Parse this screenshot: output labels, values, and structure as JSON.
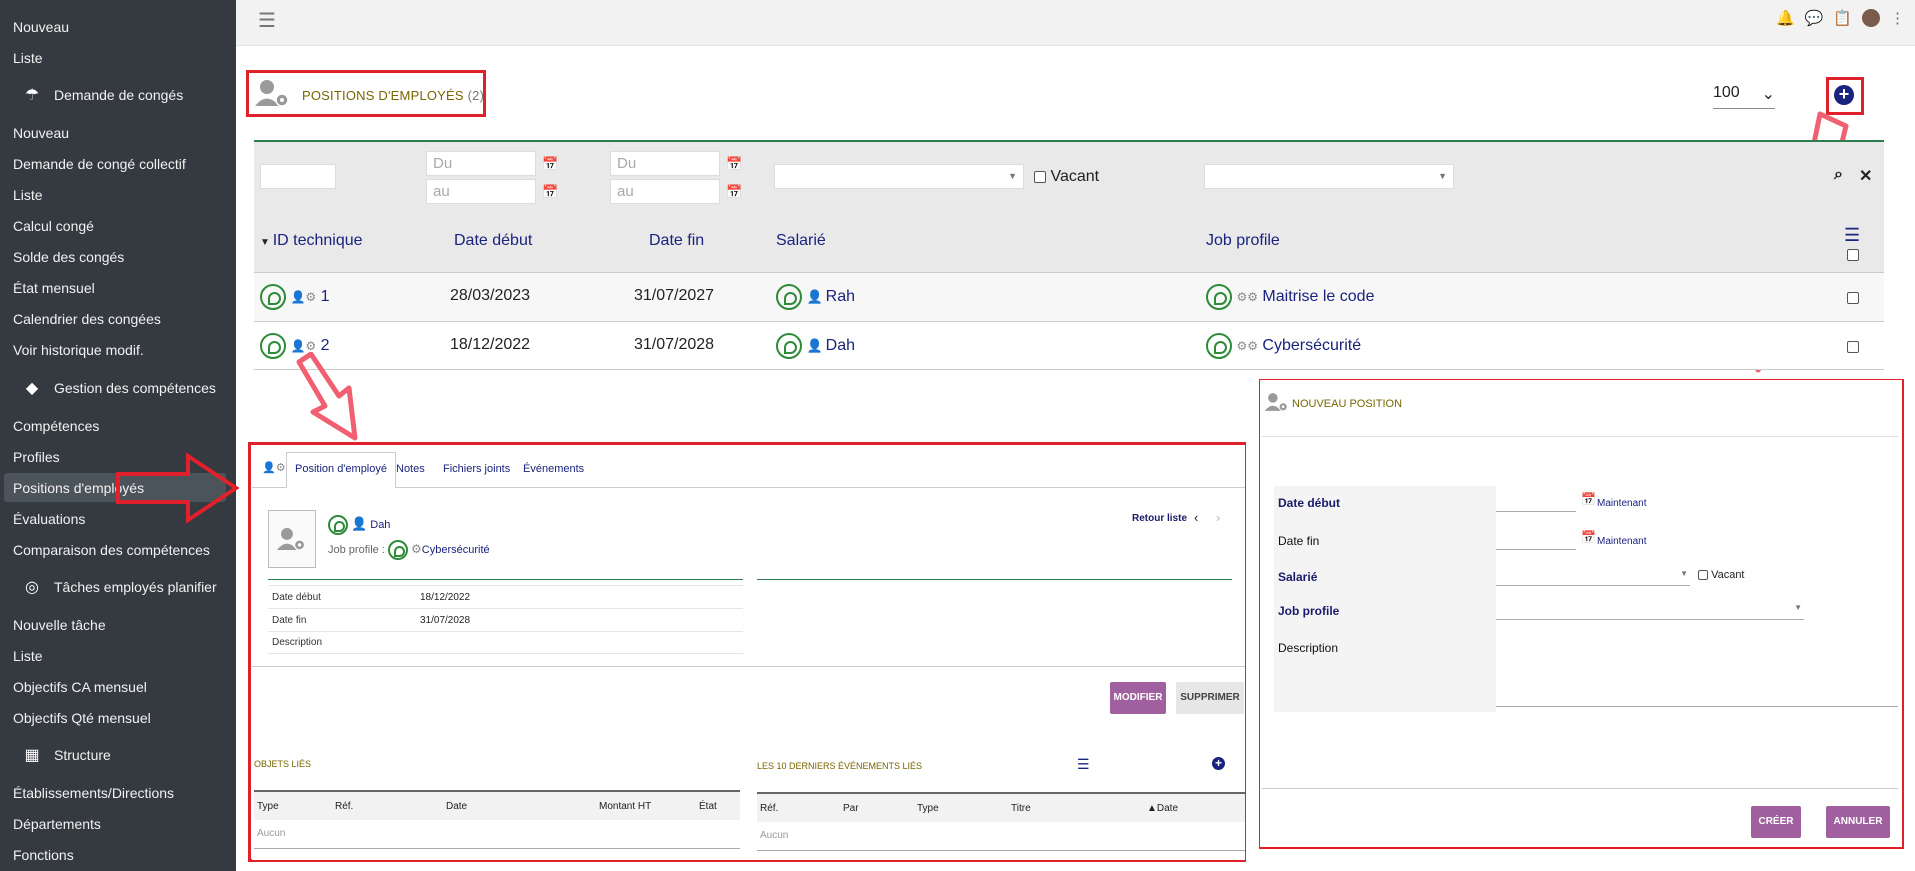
{
  "sidebar": {
    "items": [
      {
        "label": "Nouveau"
      },
      {
        "label": "Liste"
      },
      {
        "label": "Demande de congés",
        "section": true,
        "icon": "umbrella-icon"
      },
      {
        "label": "Nouveau"
      },
      {
        "label": "Demande de congé collectif"
      },
      {
        "label": "Liste"
      },
      {
        "label": "Calcul congé"
      },
      {
        "label": "Solde des congés"
      },
      {
        "label": "État mensuel"
      },
      {
        "label": "Calendrier des congées"
      },
      {
        "label": "Voir historique modif."
      },
      {
        "label": "Gestion des compétences",
        "section": true,
        "icon": "shapes-icon"
      },
      {
        "label": "Compétences"
      },
      {
        "label": "Profiles"
      },
      {
        "label": "Positions d'employés",
        "active": true
      },
      {
        "label": "Évaluations"
      },
      {
        "label": "Comparaison des compétences"
      },
      {
        "label": "Tâches employés planifier",
        "section": true,
        "icon": "target-icon"
      },
      {
        "label": "Nouvelle tâche"
      },
      {
        "label": "Liste"
      },
      {
        "label": "Objectifs CA mensuel"
      },
      {
        "label": "Objectifs Qté mensuel"
      },
      {
        "label": "Structure",
        "section": true,
        "icon": "building-icon"
      },
      {
        "label": "Établissements/Directions"
      },
      {
        "label": "Départements"
      },
      {
        "label": "Fonctions"
      }
    ]
  },
  "header": {
    "title": "POSITIONS D'EMPLOYÉS",
    "count": "(2)",
    "per_page": "100"
  },
  "filters": {
    "du_placeholder": "Du",
    "au_placeholder": "au",
    "vacant_label": "Vacant"
  },
  "table": {
    "columns": [
      "ID technique",
      "Date début",
      "Date fin",
      "Salarié",
      "Job profile"
    ],
    "rows": [
      {
        "id": "1",
        "date_debut": "28/03/2023",
        "date_fin": "31/07/2027",
        "salarie": "Rah",
        "job": "Maitrise le code"
      },
      {
        "id": "2",
        "date_debut": "18/12/2022",
        "date_fin": "31/07/2028",
        "salarie": "Dah",
        "job": "Cybersécurité"
      }
    ]
  },
  "detail": {
    "tabs": [
      "Position d'employé",
      "Notes",
      "Fichiers joints",
      "Événements"
    ],
    "salarie": "Dah",
    "job_label": "Job profile :",
    "job": "Cybersécurité",
    "retour": "Retour liste",
    "fields": [
      {
        "k": "Date début",
        "v": "18/12/2022"
      },
      {
        "k": "Date fin",
        "v": "31/07/2028"
      },
      {
        "k": "Description",
        "v": ""
      }
    ],
    "modifier": "MODIFIER",
    "supprimer": "SUPPRIMER",
    "objets_title": "OBJETS LIÉS",
    "objets_cols": [
      "Type",
      "Réf.",
      "Date",
      "Montant HT",
      "État"
    ],
    "events_title": "LES 10 DERNIERS ÉVÉNEMENTS LIÉS",
    "events_cols": [
      "Réf.",
      "Par",
      "Type",
      "Titre",
      "▲Date"
    ],
    "aucun": "Aucun"
  },
  "new_position": {
    "title": "NOUVEAU POSITION",
    "date_debut": "Date début",
    "date_fin": "Date fin",
    "salarie": "Salarié",
    "job_profile": "Job profile",
    "description": "Description",
    "maintenant": "Maintenant",
    "vacant": "Vacant",
    "creer": "CRÉER",
    "annuler": "ANNULER"
  },
  "colors": {
    "sidebar_bg": "#343a40",
    "accent_navy": "#1a237e",
    "title_olive": "#7a6400",
    "highlight_red": "#e0202a",
    "button_purple": "#a0609f"
  }
}
